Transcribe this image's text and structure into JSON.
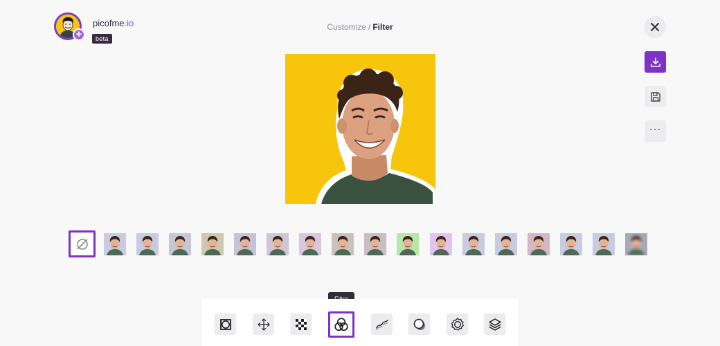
{
  "app": {
    "name": "picofme",
    "tld": ".io",
    "badge": "beta"
  },
  "breadcrumb": {
    "parent": "Customize",
    "separator": "/",
    "current": "Filter"
  },
  "actions": {
    "close_icon": "close-icon",
    "download_icon": "download-icon",
    "save_icon": "save-icon",
    "more_label": "···"
  },
  "colors": {
    "accent": "#7d34c6",
    "canvas_background": "#f8c50d"
  },
  "filters": [
    {
      "name": "none",
      "icon": "no-filter-icon",
      "selected": true
    },
    {
      "name": "filter-1",
      "tint": "#c9cbe0"
    },
    {
      "name": "filter-2",
      "tint": "#c9cbe0"
    },
    {
      "name": "filter-3",
      "tint": "#c6c8d6"
    },
    {
      "name": "filter-4",
      "tint": "#ccc9b0"
    },
    {
      "name": "filter-5",
      "tint": "#c8c2d8"
    },
    {
      "name": "filter-6",
      "tint": "#cfc6d6"
    },
    {
      "name": "filter-7",
      "tint": "#d7c8df"
    },
    {
      "name": "filter-8",
      "tint": "#c9c3bb"
    },
    {
      "name": "filter-9",
      "tint": "#c8bfc4"
    },
    {
      "name": "filter-10",
      "tint": "#b8e8a7"
    },
    {
      "name": "filter-11",
      "tint": "#e3c4f0"
    },
    {
      "name": "filter-12",
      "tint": "#c9cbe0"
    },
    {
      "name": "filter-13",
      "tint": "#c9cbe0"
    },
    {
      "name": "filter-14",
      "tint": "#d7b5c9"
    },
    {
      "name": "filter-15",
      "tint": "#c9cbe0"
    },
    {
      "name": "filter-16",
      "tint": "#c9cbe0"
    },
    {
      "name": "filter-17",
      "tint": "#a8aab8"
    }
  ],
  "toolbar": {
    "tooltip": "Filter",
    "tools": [
      {
        "name": "frame",
        "icon": "frame-icon"
      },
      {
        "name": "move",
        "icon": "move-icon"
      },
      {
        "name": "background",
        "icon": "checkerboard-icon"
      },
      {
        "name": "filter",
        "icon": "filter-icon",
        "active": true
      },
      {
        "name": "outline",
        "icon": "outline-icon"
      },
      {
        "name": "shadow",
        "icon": "shadow-icon"
      },
      {
        "name": "effects",
        "icon": "badge-icon"
      },
      {
        "name": "layers",
        "icon": "layers-icon"
      }
    ]
  }
}
